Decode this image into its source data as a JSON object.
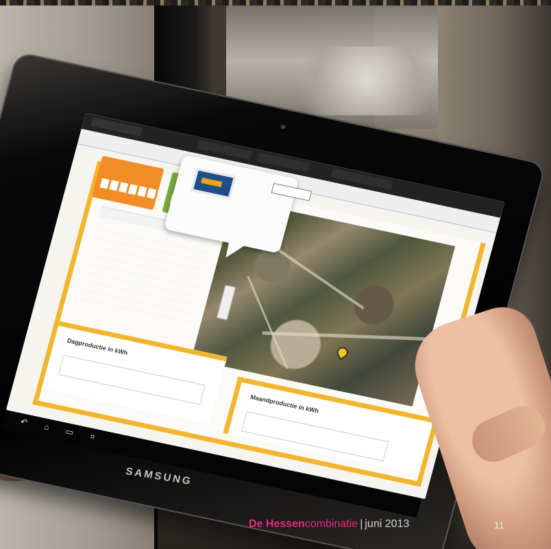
{
  "photo": {
    "subject": "tablet",
    "device_brand": "SAMSUNG"
  },
  "footer": {
    "brand_bold": "De Hessen",
    "brand_suffix": "combinatie",
    "separator": "|",
    "issue_date": "juni 2013",
    "page_number": "11"
  },
  "screen": {
    "browser_tabs": [
      "",
      "",
      "",
      ""
    ],
    "nav_items": [
      "",
      "",
      "",
      ""
    ],
    "cards": [
      {
        "title": "",
        "digits": [
          "",
          "",
          "",
          "",
          "",
          ""
        ]
      },
      {
        "title": "",
        "digits": [
          "",
          "",
          "",
          "",
          "",
          ""
        ]
      }
    ],
    "info_title": "",
    "map_select": "",
    "bottom_left_title": "Dagproductie in kWh",
    "bottom_right_title": "Maandproductie in kWh"
  },
  "colors": {
    "brand_pink": "#e72881",
    "screen_yellow": "#f2b52d",
    "orange_card": "#f28c24",
    "green_card": "#78ad3a"
  },
  "icons": {
    "android_back": "back-icon",
    "android_home": "home-icon",
    "android_recent": "recent-apps-icon",
    "android_screenshot": "screenshot-icon",
    "map_pin": "map-pin-icon"
  }
}
